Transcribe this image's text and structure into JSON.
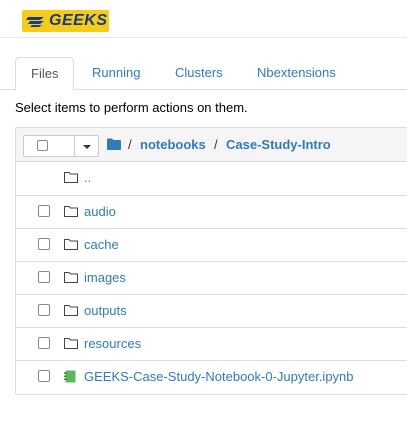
{
  "header": {
    "logo_text": "GEEKS"
  },
  "tabs": [
    {
      "label": "Files",
      "active": true
    },
    {
      "label": "Running",
      "active": false
    },
    {
      "label": "Clusters",
      "active": false
    },
    {
      "label": "Nbextensions",
      "active": false
    }
  ],
  "hint": "Select items to perform actions on them.",
  "breadcrumb": {
    "separator": "/",
    "parts": [
      "notebooks",
      "Case-Study-Intro"
    ]
  },
  "items": [
    {
      "name": "..",
      "type": "folder",
      "checkbox": false
    },
    {
      "name": "audio",
      "type": "folder",
      "checkbox": true
    },
    {
      "name": "cache",
      "type": "folder",
      "checkbox": true
    },
    {
      "name": "images",
      "type": "folder",
      "checkbox": true
    },
    {
      "name": "outputs",
      "type": "folder",
      "checkbox": true
    },
    {
      "name": "resources",
      "type": "folder",
      "checkbox": true
    },
    {
      "name": "GEEKS-Case-Study-Notebook-0-Jupyter.ipynb",
      "type": "notebook",
      "checkbox": true
    }
  ],
  "colors": {
    "link": "#337ab7",
    "notebook_icon": "#5cb85c",
    "logo_bg": "#f5cb1c"
  }
}
